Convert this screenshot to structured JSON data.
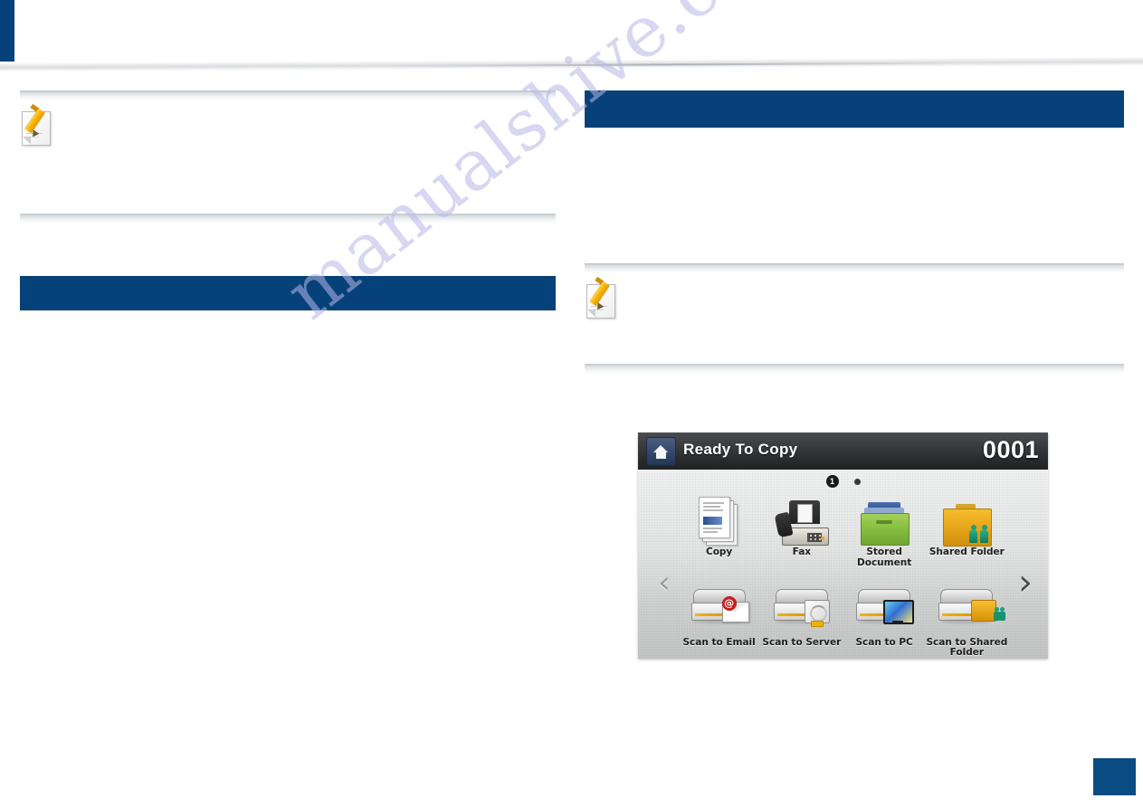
{
  "document": {
    "watermark": "manualshive.com",
    "masthead": "",
    "left_column": {
      "note": {
        "icon": "note-pencil-icon",
        "text": ""
      },
      "section_header": ""
    },
    "right_column": {
      "section_header": "",
      "body_text": "",
      "note": {
        "icon": "note-pencil-icon",
        "text": ""
      }
    }
  },
  "lcd": {
    "accent_blue": "#064279",
    "title_bar": {
      "home_icon": "home-icon",
      "status": "Ready To Copy",
      "counter": "0001"
    },
    "pager": {
      "current": "1",
      "pages": 2
    },
    "nav": {
      "prev": "‹",
      "next": "›"
    },
    "rows": [
      [
        {
          "label": "Copy",
          "icon": "copy-document-icon"
        },
        {
          "label": "Fax",
          "icon": "fax-machine-icon"
        },
        {
          "label": "Stored\nDocument",
          "label_line1": "Stored",
          "label_line2": "Document",
          "icon": "stored-document-icon"
        },
        {
          "label": "Shared Folder",
          "icon": "shared-folder-icon"
        }
      ],
      [
        {
          "label": "Scan to Email",
          "icon": "scan-to-email-icon"
        },
        {
          "label": "Scan to Server",
          "icon": "scan-to-server-icon"
        },
        {
          "label": "Scan to PC",
          "icon": "scan-to-pc-icon"
        },
        {
          "label": "Scan to Shared\nFolder",
          "label_line1": "Scan to Shared",
          "label_line2": "Folder",
          "icon": "scan-to-shared-folder-icon"
        }
      ]
    ]
  }
}
